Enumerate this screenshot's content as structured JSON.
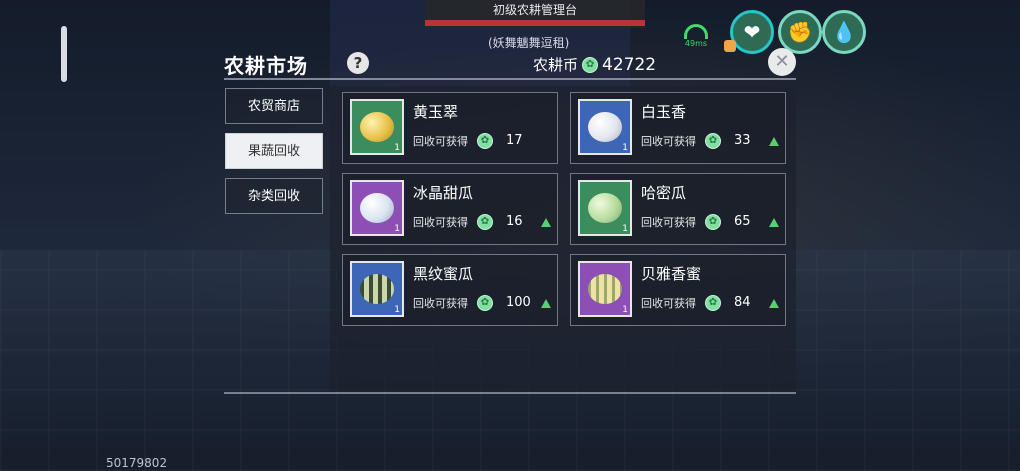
{
  "top_banner": {
    "title": "初级农耕管理台",
    "owner": "(妖舞魑舞逗租)"
  },
  "hud": {
    "ping_text": "49ms"
  },
  "market": {
    "title": "农耕市场",
    "help": "?",
    "currency_label": "农耕币",
    "currency_amount": "42722",
    "close": "✕"
  },
  "tabs": [
    {
      "label": "农贸商店",
      "active": false
    },
    {
      "label": "果蔬回收",
      "active": true
    },
    {
      "label": "杂类回收",
      "active": false
    }
  ],
  "items": [
    {
      "name": "黄玉翠",
      "reward_label": "回收可获得",
      "price": "17",
      "qty": "1",
      "trend": "none",
      "thumb_color": "green",
      "fruit_color": "#e8c24a"
    },
    {
      "name": "白玉香",
      "reward_label": "回收可获得",
      "price": "33",
      "qty": "1",
      "trend": "up",
      "thumb_color": "blue",
      "fruit_color": "#f1f3f7"
    },
    {
      "name": "冰晶甜瓜",
      "reward_label": "回收可获得",
      "price": "16",
      "qty": "1",
      "trend": "up",
      "thumb_color": "purple",
      "fruit_color": "#dbe4f0"
    },
    {
      "name": "哈密瓜",
      "reward_label": "回收可获得",
      "price": "65",
      "qty": "1",
      "trend": "up",
      "thumb_color": "green",
      "fruit_color": "#b9dca0"
    },
    {
      "name": "黑纹蜜瓜",
      "reward_label": "回收可获得",
      "price": "100",
      "qty": "1",
      "trend": "up",
      "thumb_color": "blue",
      "fruit_color": "#8e9e74"
    },
    {
      "name": "贝雅香蜜",
      "reward_label": "回收可获得",
      "price": "84",
      "qty": "1",
      "trend": "up",
      "thumb_color": "purple",
      "fruit_color": "#e7d79a"
    }
  ],
  "footer": {
    "uid": "50179802"
  },
  "colors": {
    "accent_green": "#57d070",
    "banner_red": "#b8333a"
  }
}
